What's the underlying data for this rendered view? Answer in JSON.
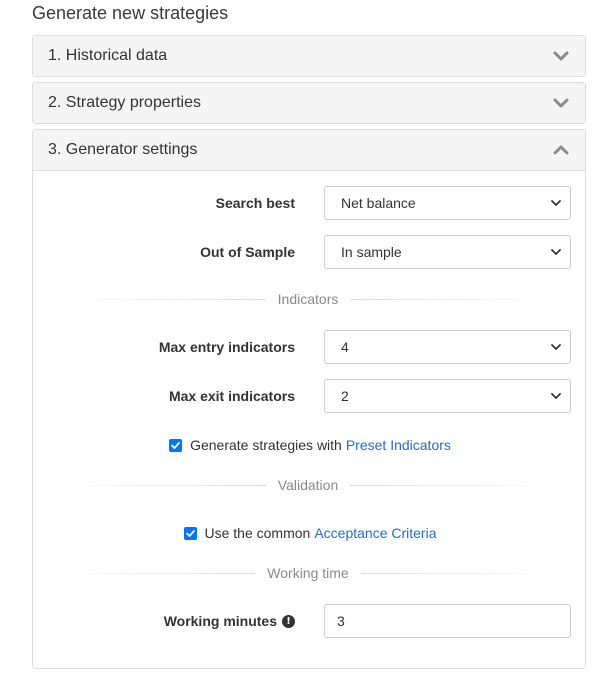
{
  "page": {
    "title": "Generate new strategies"
  },
  "panels": [
    {
      "label": "1. Historical data",
      "state": "collapsed"
    },
    {
      "label": "2. Strategy properties",
      "state": "collapsed"
    },
    {
      "label": "3. Generator settings",
      "state": "expanded"
    }
  ],
  "generator": {
    "search_best": {
      "label": "Search best",
      "value": "Net balance"
    },
    "out_of_sample": {
      "label": "Out of Sample",
      "value": "In sample"
    },
    "indicators_section": "Indicators",
    "max_entry": {
      "label": "Max entry indicators",
      "value": "4"
    },
    "max_exit": {
      "label": "Max exit indicators",
      "value": "2"
    },
    "preset": {
      "checked": true,
      "text": "Generate strategies with",
      "link": "Preset Indicators"
    },
    "validation_section": "Validation",
    "acceptance": {
      "checked": true,
      "text": "Use the common",
      "link": "Acceptance Criteria"
    },
    "working_time_section": "Working time",
    "working_minutes": {
      "label": "Working minutes",
      "value": "3"
    }
  },
  "colors": {
    "link": "#2a6db5",
    "checkbox": "#0075ff",
    "header_bg": "#f5f5f5",
    "border": "#dddddd"
  }
}
